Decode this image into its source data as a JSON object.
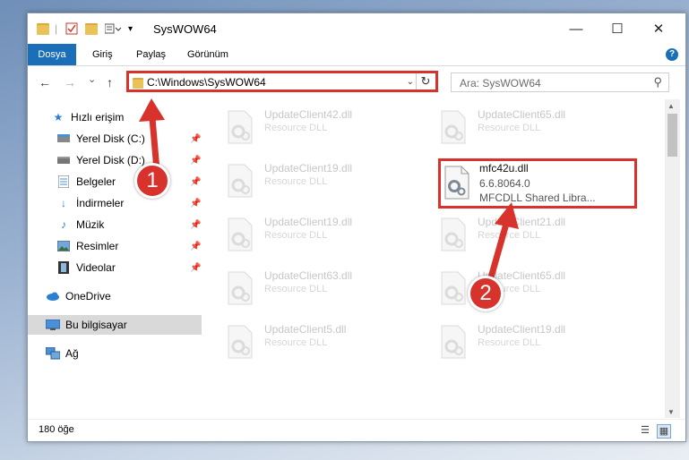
{
  "window": {
    "title": "SysWOW64",
    "minimize": "—",
    "maximize": "☐",
    "close": "✕"
  },
  "ribbon": {
    "tabs": [
      "Dosya",
      "Giriş",
      "Paylaş",
      "Görünüm"
    ],
    "help": "?"
  },
  "nav": {
    "back": "←",
    "forward": "→",
    "recent": "⌄",
    "up": "↑",
    "address": "C:\\Windows\\SysWOW64",
    "refresh": "↻",
    "search_placeholder": "Ara: SysWOW64"
  },
  "sidebar": {
    "items": [
      {
        "label": "Hızlı erişim",
        "icon": "star-icon"
      },
      {
        "label": "Yerel Disk (C:)",
        "icon": "drive-icon"
      },
      {
        "label": "Yerel Disk (D:)",
        "icon": "drive-icon"
      },
      {
        "label": "Belgeler",
        "icon": "documents-icon"
      },
      {
        "label": "İndirmeler",
        "icon": "download-icon"
      },
      {
        "label": "Müzik",
        "icon": "music-icon"
      },
      {
        "label": "Resimler",
        "icon": "pictures-icon"
      },
      {
        "label": "Videolar",
        "icon": "videos-icon"
      },
      {
        "label": "OneDrive",
        "icon": "cloud-icon"
      },
      {
        "label": "Bu bilgisayar",
        "icon": "computer-icon"
      },
      {
        "label": "Ağ",
        "icon": "network-icon"
      }
    ]
  },
  "files": [
    {
      "name": "UpdateClient42.dll",
      "desc": "Resource DLL"
    },
    {
      "name": "UpdateClient65.dll",
      "desc": "Resource DLL"
    },
    {
      "name": "UpdateClient19.dll",
      "desc": "Resource DLL"
    },
    {
      "name": "UpdateClient19.dll",
      "desc": "Resource DLL"
    },
    {
      "name": "UpdateClient21.dll",
      "desc": "Resource DLL"
    },
    {
      "name": "UpdateClient63.dll",
      "desc": "Resource DLL"
    },
    {
      "name": "UpdateClient65.dll",
      "desc": "Resource DLL"
    },
    {
      "name": "UpdateClient5.dll",
      "desc": "Resource DLL"
    },
    {
      "name": "UpdateClient19.dll",
      "desc": "Resource DLL"
    }
  ],
  "highlighted_file": {
    "name": "mfc42u.dll",
    "version": "6.6.8064.0",
    "desc": "MFCDLL Shared Libra..."
  },
  "status": {
    "count": "180 öğe"
  },
  "annotations": {
    "step1": "1",
    "step2": "2",
    "accent": "#d7332c"
  }
}
